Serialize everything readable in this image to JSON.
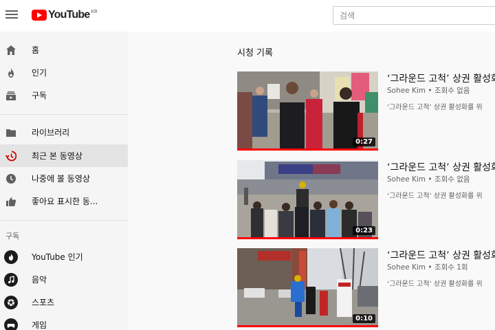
{
  "header": {
    "logo_text": "YouTube",
    "logo_region": "KR",
    "search_placeholder": "검색"
  },
  "sidebar": {
    "main": [
      {
        "label": "홈",
        "icon": "home-icon"
      },
      {
        "label": "인기",
        "icon": "flame-icon"
      },
      {
        "label": "구독",
        "icon": "subscriptions-icon"
      }
    ],
    "library": [
      {
        "label": "라이브러리",
        "icon": "folder-icon"
      },
      {
        "label": "최근 본 동영상",
        "icon": "history-icon",
        "active": true
      },
      {
        "label": "나중에 볼 동영상",
        "icon": "clock-icon"
      },
      {
        "label": "좋아요 표시한 동...",
        "icon": "thumbs-up-icon"
      }
    ],
    "subscriptions_title": "구독",
    "subscriptions": [
      {
        "label": "YouTube 인기",
        "icon": "trending-channel-icon"
      },
      {
        "label": "음악",
        "icon": "music-channel-icon"
      },
      {
        "label": "스포츠",
        "icon": "sports-channel-icon"
      },
      {
        "label": "게임",
        "icon": "gaming-channel-icon"
      }
    ]
  },
  "main": {
    "title": "시청 기록",
    "videos": [
      {
        "title": "‘그라운드 고척’ 상권 활성화",
        "channel": "Sohee Kim",
        "views": "조회수 없음",
        "description": "‘그라운드 고척’ 상권 활성화를 위",
        "duration": "0:27",
        "watched_fraction": 1.0
      },
      {
        "title": "‘그라운드 고척’ 상권 활성화",
        "channel": "Sohee Kim",
        "views": "조회수 없음",
        "description": "‘그라운드 고척’ 상권 활성화를 위",
        "duration": "0:23",
        "watched_fraction": 1.0
      },
      {
        "title": "‘그라운드 고척’ 상권 활성화",
        "channel": "Sohee Kim",
        "views": "조회수 1회",
        "description": "‘그라운드 고척’ 상권 활성화를 위",
        "duration": "0:10",
        "watched_fraction": 1.0
      }
    ]
  },
  "colors": {
    "brand_red": "#ff0000",
    "progress_red": "#ff0000",
    "sidebar_bg": "#f5f5f5",
    "active_bg": "#e4e4e4",
    "history_icon": "#cc0000"
  }
}
